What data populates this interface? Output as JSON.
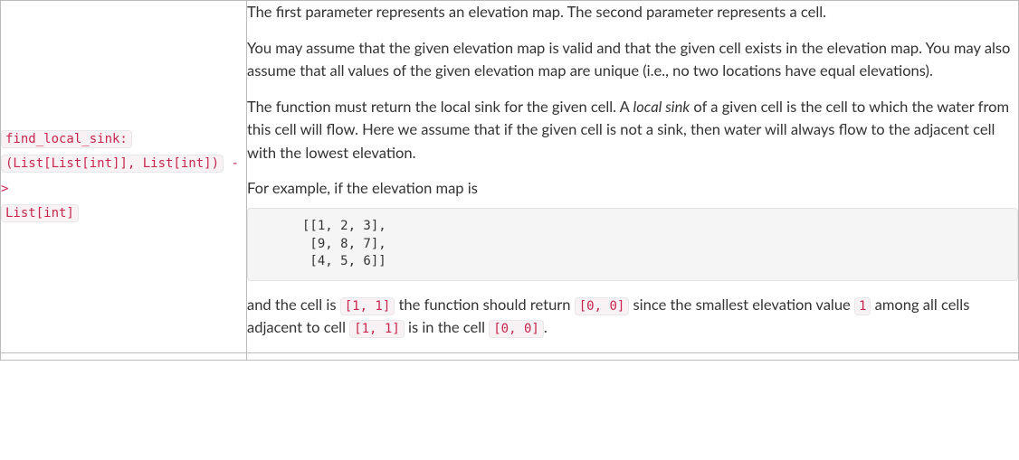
{
  "left": {
    "fn_name": "find_local_sink:",
    "sig_open": "(List[List[int]], List[int])",
    "sig_arrow": " ->",
    "sig_ret": "List[int]"
  },
  "right": {
    "p1": "The first parameter represents an elevation map. The second parameter represents a cell.",
    "p2": "You may assume that the given elevation map is valid and that the given cell exists in the elevation map. You may also assume that all values of the given elevation map are unique (i.e., no two locations have equal elevations).",
    "p3a": "The function must return the local sink for the given cell. A ",
    "p3_em": "local sink",
    "p3b": " of a given cell is the cell to which the water from this cell will flow. Here we assume that if the given cell is not a sink, then water will always flow to the adjacent cell with the lowest elevation.",
    "p4": "For example, if the elevation map is",
    "code": "[[1, 2, 3],\n [9, 8, 7],\n [4, 5, 6]]",
    "p5a": "and the cell is ",
    "c1": "[1, 1]",
    "p5b": " the function should return ",
    "c2": "[0, 0]",
    "p5c": " since the smallest elevation value ",
    "c3": "1",
    "p5d": " among all cells adjacent to cell ",
    "c4": "[1, 1]",
    "p5e": " is in the cell ",
    "c5": "[0, 0]",
    "p5f": "."
  }
}
